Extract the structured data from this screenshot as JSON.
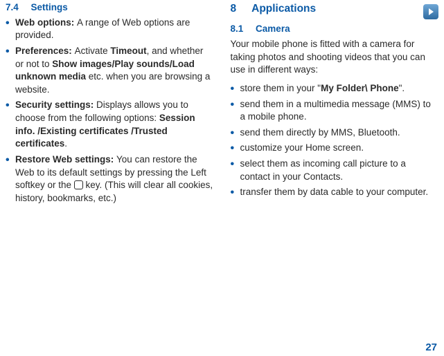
{
  "left": {
    "sec_num": "7.4",
    "sec_title": "Settings",
    "items": [
      {
        "lead": "Web options: ",
        "text": "A range of Web options are provided."
      },
      {
        "lead": "Preferences: ",
        "t1": "Activate ",
        "b1": "Timeout",
        "t2": ", and whether or not to ",
        "b2": "Show images/Play sounds/Load unknown media",
        "t3": " etc. when you are browsing a website."
      },
      {
        "lead": "Security settings: ",
        "t1": "Displays allows you to choose from the following options: ",
        "b1": "Session info. /Existing certificates /Trusted certificates",
        "t2": "."
      },
      {
        "lead": "Restore Web settings: ",
        "t1": "You can restore the Web to its default settings by pressing the Left softkey or the ",
        "t2": " key. (This will clear all cookies, history, bookmarks, etc.)"
      }
    ]
  },
  "right": {
    "chap_num": "8",
    "chap_title": "Applications",
    "sec_num": "8.1",
    "sec_title": "Camera",
    "intro": "Your mobile phone is fitted with a camera for taking photos and shooting videos that you can use in different ways:",
    "items": [
      {
        "t1": "store them in your \"",
        "b1": "My Folder\\ Phone",
        "t2": "\"."
      },
      {
        "t1": "send them in a multimedia message (MMS) to a mobile phone."
      },
      {
        "t1": "send them directly by MMS, Bluetooth."
      },
      {
        "t1": "customize your Home screen."
      },
      {
        "t1": "select them as incoming call picture to a contact in your Contacts."
      },
      {
        "t1": "transfer them by data cable to your computer."
      }
    ]
  },
  "page_number": "27"
}
